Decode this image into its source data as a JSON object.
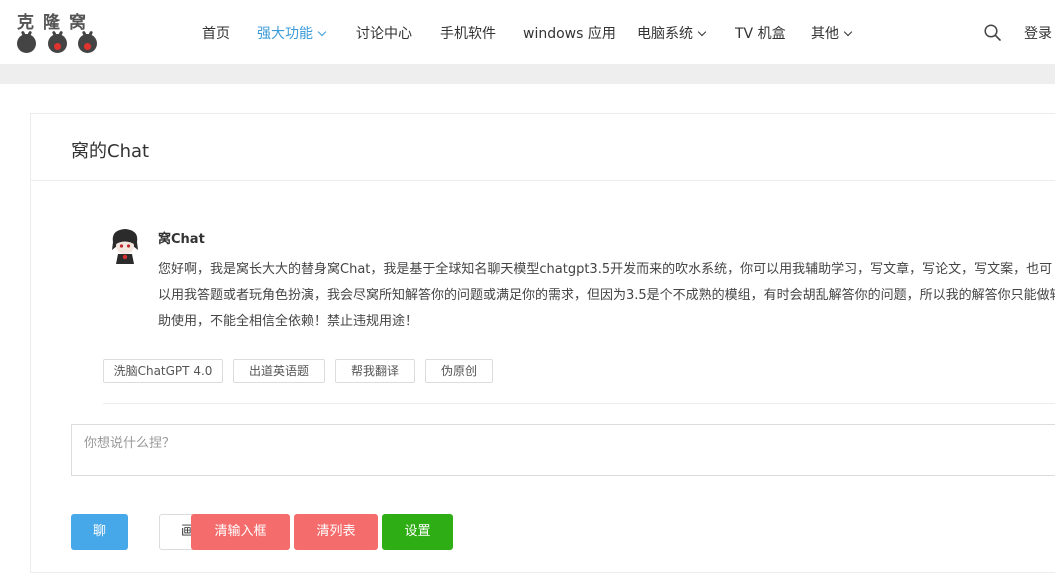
{
  "logo": {
    "text": "克隆窝"
  },
  "nav": {
    "items": [
      {
        "label": "首页",
        "active": false,
        "dropdown": false
      },
      {
        "label": "强大功能",
        "active": true,
        "dropdown": true
      },
      {
        "label": "讨论中心",
        "active": false,
        "dropdown": false
      },
      {
        "label": "手机软件",
        "active": false,
        "dropdown": false
      },
      {
        "label": "windows 应用",
        "active": false,
        "dropdown": false
      },
      {
        "label": "电脑系统",
        "active": false,
        "dropdown": true
      },
      {
        "label": "TV 机盒",
        "active": false,
        "dropdown": false
      },
      {
        "label": "其他",
        "active": false,
        "dropdown": true
      }
    ],
    "login": "登录",
    "active_color": "#3b9bd9"
  },
  "card": {
    "title": "窝的Chat",
    "bot_name": "窝Chat",
    "bot_message": "您好啊，我是窝长大大的替身窝Chat，我是基于全球知名聊天模型chatgpt3.5开发而来的吹水系统，你可以用我辅助学习，写文章，写论文，写文案，也可以用我答题或者玩角色扮演，我会尽窝所知解答你的问题或满足你的需求，但因为3.5是个不成熟的模组，有时会胡乱解答你的问题，所以我的解答你只能做辅助使用，不能全相信全依赖！禁止违规用途！",
    "chips": [
      "洗脑ChatGPT 4.0",
      "出道英语题",
      "帮我翻译",
      "伪原创"
    ],
    "input_placeholder": "你想说什么捏？",
    "buttons": {
      "chat": "聊",
      "draw": "画",
      "clear_input": "清输入框",
      "clear_list": "清列表",
      "settings": "设置"
    }
  },
  "colors": {
    "chat_button": "#46a7e9",
    "danger_button": "#f56c6c",
    "settings_button": "#2ead14"
  }
}
